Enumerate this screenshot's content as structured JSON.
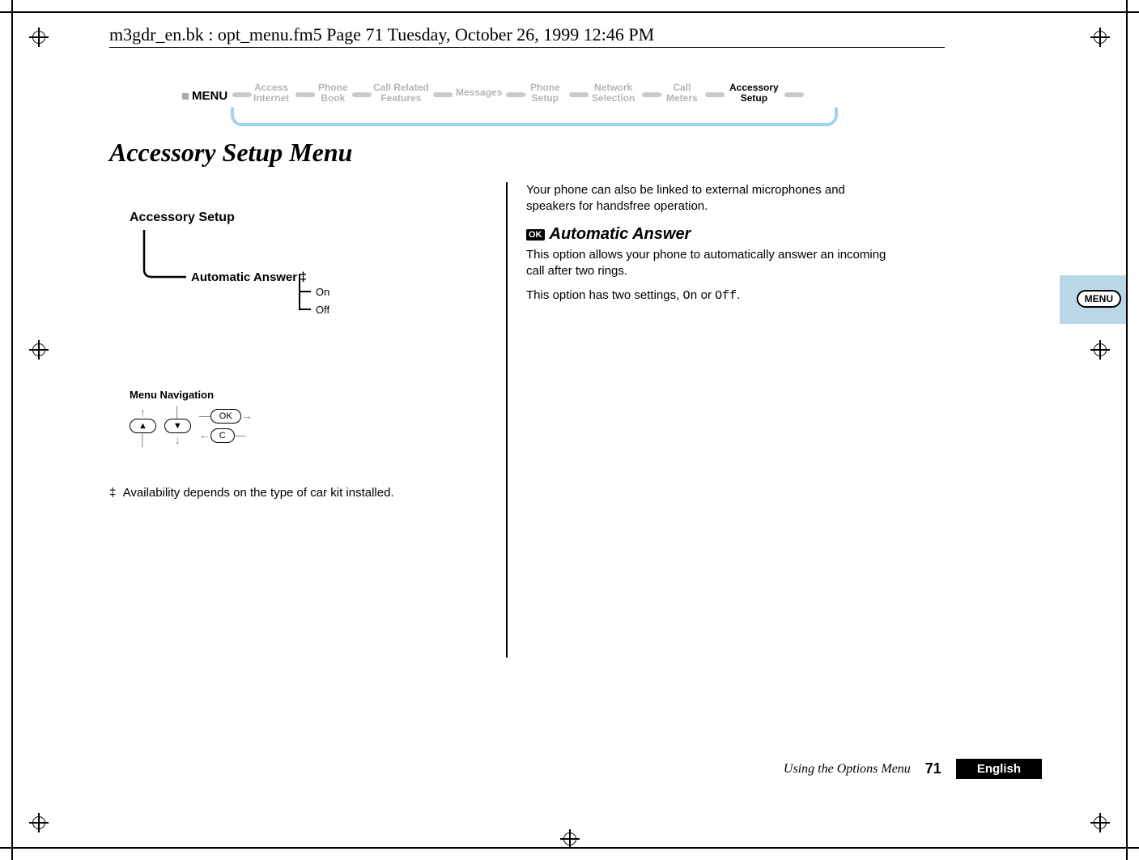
{
  "header": {
    "running_head": "m3gdr_en.bk : opt_menu.fm5  Page 71  Tuesday, October 26, 1999  12:46 PM"
  },
  "breadcrumb": {
    "menu_label": "MENU",
    "items": [
      {
        "line1": "Access",
        "line2": "Internet",
        "active": false
      },
      {
        "line1": "Phone",
        "line2": "Book",
        "active": false
      },
      {
        "line1": "Call Related",
        "line2": "Features",
        "active": false
      },
      {
        "line1": "Messages",
        "line2": "",
        "active": false
      },
      {
        "line1": "Phone",
        "line2": "Setup",
        "active": false
      },
      {
        "line1": "Network",
        "line2": "Selection",
        "active": false
      },
      {
        "line1": "Call",
        "line2": "Meters",
        "active": false
      },
      {
        "line1": "Accessory",
        "line2": "Setup",
        "active": true
      }
    ]
  },
  "title": "Accessory Setup Menu",
  "tree": {
    "root": "Accessory Setup",
    "child": "Automatic Answer",
    "child_marker": "‡",
    "options": [
      "On",
      "Off"
    ]
  },
  "menu_nav": {
    "title": "Menu Navigation",
    "keys": {
      "up": "▲",
      "down": "▼",
      "ok": "OK",
      "c": "C"
    }
  },
  "footnote": {
    "marker": "‡",
    "text": "Availability depends on the type of car kit installed."
  },
  "right_col": {
    "intro": "Your phone can also be linked to external microphones and speakers for handsfree operation.",
    "ok_badge": "OK",
    "section_title": "Automatic Answer",
    "p1": "This option allows your phone to automatically answer an incoming call after two rings.",
    "p2_a": "This option has two settings, ",
    "p2_on": "On",
    "p2_mid": " or ",
    "p2_off": "Off",
    "p2_end": "."
  },
  "side_tab": {
    "label": "MENU"
  },
  "footer": {
    "section": "Using the Options Menu",
    "page": "71",
    "lang": "English"
  }
}
